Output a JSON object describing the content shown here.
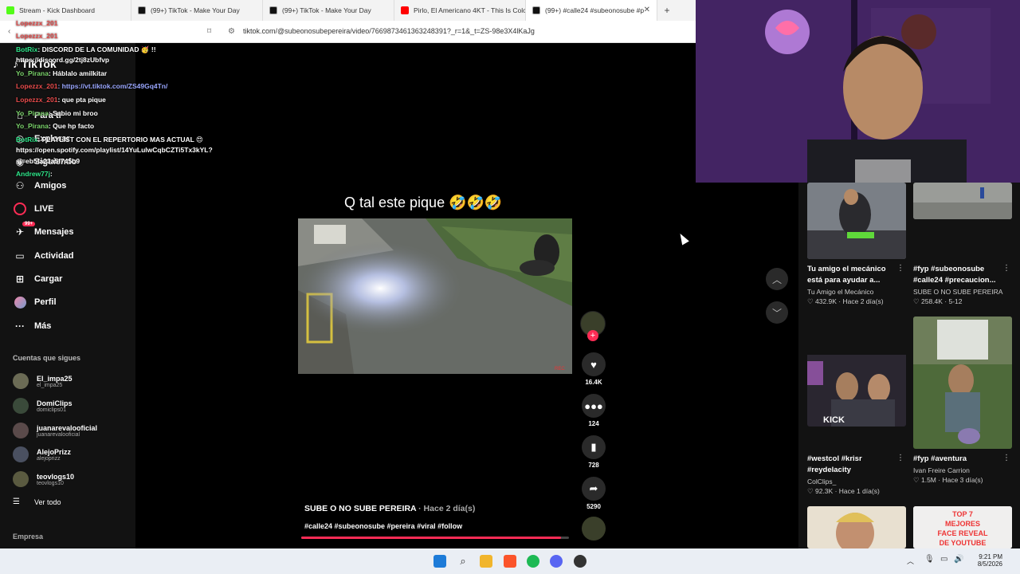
{
  "browser": {
    "tabs": [
      {
        "label": "Stream - Kick Dashboard",
        "color": "#53fc18"
      },
      {
        "label": "(99+) TikTok - Make Your Day",
        "color": "#111111"
      },
      {
        "label": "(99+) TikTok - Make Your Day",
        "color": "#111111"
      },
      {
        "label": "Pirlo, El Americano 4KT - This Is Colo",
        "color": "#ff0000"
      },
      {
        "label": "(99+) #calle24 #subeonosube #p",
        "color": "#111111"
      }
    ],
    "url": "tiktok.com/@subeonosubepereira/video/7669873461363248391?_r=1&_t=ZS-98e3X4lKaJg"
  },
  "sidebar": {
    "logo": "TikTok",
    "items": [
      {
        "label": "Para ti",
        "icon": "home-icon"
      },
      {
        "label": "Explorar",
        "icon": "compass-icon"
      },
      {
        "label": "Siguiendo",
        "icon": "following-icon"
      },
      {
        "label": "Amigos",
        "icon": "friends-icon"
      },
      {
        "label": "LIVE",
        "icon": "live-icon"
      },
      {
        "label": "Mensajes",
        "icon": "messages-icon",
        "badge": "99+"
      },
      {
        "label": "Actividad",
        "icon": "activity-icon"
      },
      {
        "label": "Cargar",
        "icon": "upload-icon"
      },
      {
        "label": "Perfil",
        "icon": "profile-icon"
      },
      {
        "label": "Más",
        "icon": "more-icon"
      }
    ],
    "following_title": "Cuentas que sigues",
    "following": [
      {
        "name": "El_impa25",
        "handle": "el_impa25"
      },
      {
        "name": "DomiClips",
        "handle": "domiclips01"
      },
      {
        "name": "juanarevalooficial",
        "handle": "juanarevalooficial"
      },
      {
        "name": "AlejoPrizz",
        "handle": "alejoprizz"
      },
      {
        "name": "teovlogs10",
        "handle": "teovlogs10"
      }
    ],
    "see_all": "Ver todo",
    "empresa": "Empresa"
  },
  "chat": [
    {
      "user": "Lopezzx_201",
      "msg": "",
      "cls": "red"
    },
    {
      "user": "Lopezzx_201",
      "msg": "",
      "cls": "red"
    },
    {
      "user": "BotRix",
      "msg": ": DISCORD DE LA COMUNIDAD 🥳 !!",
      "cls": ""
    },
    {
      "user": "",
      "msg": "https://discord.gg/2tj8zUbfvp",
      "cls": ""
    },
    {
      "user": "Yo_Pirana",
      "msg": ": Háblalo amilkitar",
      "cls": "green2"
    },
    {
      "user": "Lopezzx_201",
      "msg": ": https://vt.tiktok.com/ZS49Gq4Tn/",
      "cls": "red",
      "link": true
    },
    {
      "user": "Lopezzx_201",
      "msg": ": que pta pique",
      "cls": "red"
    },
    {
      "user": "Yo_Pirana",
      "msg": ": Sabio mi broo",
      "cls": "green2"
    },
    {
      "user": "Yo_Pirana",
      "msg": ": Que hp facto",
      "cls": "green2"
    },
    {
      "user": "BotRix",
      "msg": ": PLAYLIST CON EL REPERTORIO MAS ACTUAL 😍",
      "cls": ""
    },
    {
      "user": "",
      "msg": "https://open.spotify.com/playlist/14YuLulwCqbCZTi5Tx3kYL?",
      "cls": ""
    },
    {
      "user": "",
      "msg": "si=eb5fa23a5f745b9",
      "cls": ""
    },
    {
      "user": "Andrew77j",
      "msg": ":",
      "cls": ""
    }
  ],
  "video": {
    "caption_top": "Q tal este pique 🤣🤣🤣",
    "author": "SUBE O NO SUBE PEREIRA",
    "time": "· Hace 2 día(s)",
    "tags": "#calle24 #subeonosube #pereira #viral #follow",
    "progress": 0.97,
    "likes": "16.4K",
    "comments": "124",
    "saves": "728",
    "shares": "5290"
  },
  "related": [
    {
      "title": "Tu amigo el mecánico está para ayudar a...",
      "author": "Tu Amigo el Mecánico",
      "views": "432.9K",
      "time": "Hace 2 día(s)"
    },
    {
      "title": "#fyp #subeonosube #calle24 #precaucion...",
      "author": "SUBE O NO SUBE PEREIRA",
      "views": "258.4K",
      "time": "5-12"
    },
    {
      "title": "#westcol #krisr #reydelacity",
      "author": "ColClips_",
      "views": "92.3K",
      "time": "Hace 1 día(s)"
    },
    {
      "title": "#fyp #aventura",
      "author": "Ivan Freire Carrion",
      "views": "1.5M",
      "time": "Hace 3 día(s)"
    }
  ],
  "thumb_text": {
    "kick": "KICK",
    "top7a": "TOP 7",
    "top7b": "MEJORES",
    "top7c": "FACE REVEAL",
    "top7d": "DE YOUTUBE"
  },
  "taskbar": {
    "time": "9:21 PM",
    "date": "8/5/2026"
  }
}
